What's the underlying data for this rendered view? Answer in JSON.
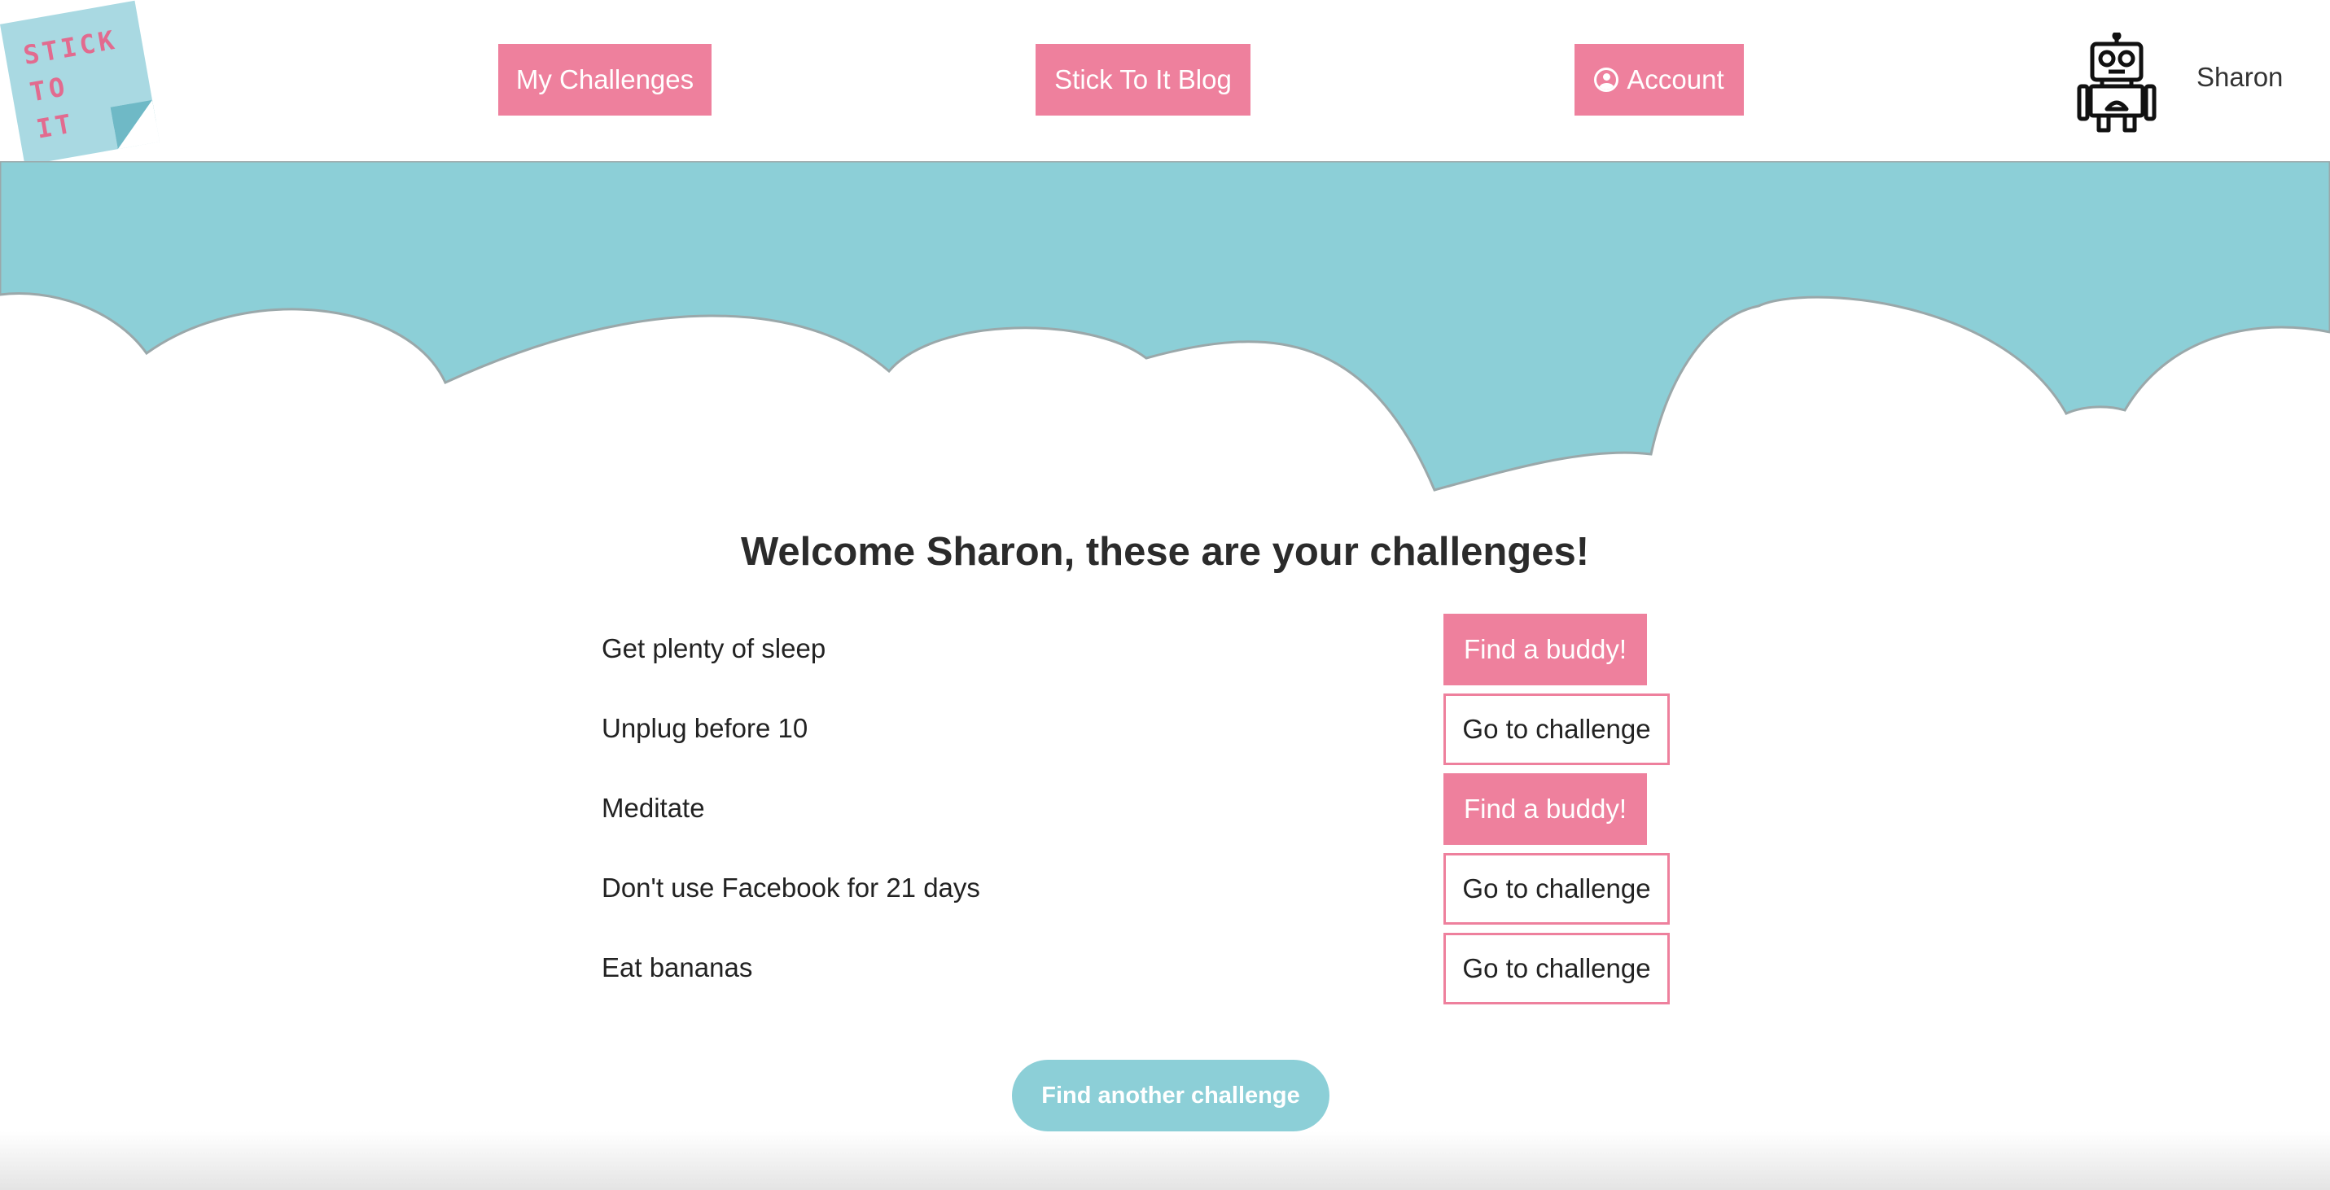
{
  "brand": {
    "logo_text": "STICK\nTO\nIT",
    "accent_pink": "#ee809d",
    "accent_teal": "#8ccfd7"
  },
  "nav": {
    "my_challenges": "My Challenges",
    "blog": "Stick To It Blog",
    "account": "Account",
    "account_icon": "user-circle-icon"
  },
  "user": {
    "name": "Sharon",
    "avatar_icon": "robot-icon"
  },
  "main": {
    "title": "Welcome Sharon, these are your challenges!",
    "challenges": [
      {
        "label": "Get plenty of sleep",
        "action": "Find a buddy!"
      },
      {
        "label": "Unplug before 10",
        "action": "Go to challenge"
      },
      {
        "label": "Meditate",
        "action": "Find a buddy!"
      },
      {
        "label": "Don't use Facebook for 21 days",
        "action": "Go to challenge"
      },
      {
        "label": "Eat bananas",
        "action": "Go to challenge"
      }
    ],
    "find_another": "Find another challenge"
  }
}
